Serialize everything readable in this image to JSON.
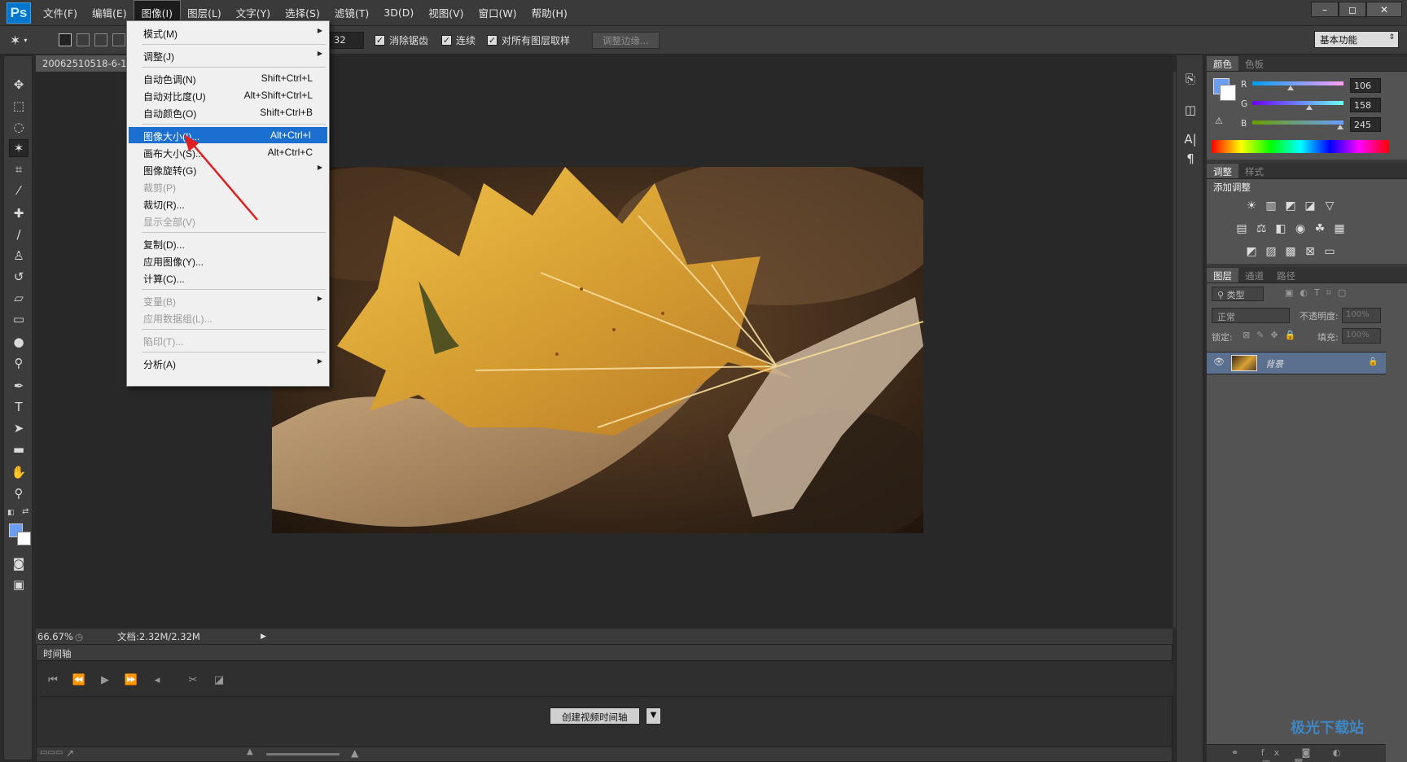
{
  "app": {
    "logo": "Ps"
  },
  "menubar": {
    "items": [
      "文件(F)",
      "编辑(E)",
      "图像(I)",
      "图层(L)",
      "文字(Y)",
      "选择(S)",
      "滤镜(T)",
      "3D(D)",
      "视图(V)",
      "窗口(W)",
      "帮助(H)"
    ],
    "active_index": 2
  },
  "window_controls": {
    "minimize": "–",
    "restore": "◻",
    "close": "✕"
  },
  "options": {
    "tolerance_value": "32",
    "antialias_label": "消除锯齿",
    "contiguous_label": "连续",
    "sample_all_label": "对所有图层取样",
    "refine_edge_label": "调整边缘...",
    "workspace_value": "基本功能"
  },
  "document": {
    "tab_title": "20062510518-6-12",
    "zoom": "66.67%",
    "doc_info": "文档:2.32M/2.32M"
  },
  "image_menu": [
    {
      "label": "模式(M)",
      "shortcut": "",
      "submenu": true,
      "disabled": false
    },
    {
      "separator": true
    },
    {
      "label": "调整(J)",
      "shortcut": "",
      "submenu": true,
      "disabled": false
    },
    {
      "separator": true
    },
    {
      "label": "自动色调(N)",
      "shortcut": "Shift+Ctrl+L",
      "disabled": false
    },
    {
      "label": "自动对比度(U)",
      "shortcut": "Alt+Shift+Ctrl+L",
      "disabled": false
    },
    {
      "label": "自动颜色(O)",
      "shortcut": "Shift+Ctrl+B",
      "disabled": false
    },
    {
      "separator": true
    },
    {
      "label": "图像大小(I)...",
      "shortcut": "Alt+Ctrl+I",
      "disabled": false,
      "highlighted": true
    },
    {
      "label": "画布大小(S)...",
      "shortcut": "Alt+Ctrl+C",
      "disabled": false
    },
    {
      "label": "图像旋转(G)",
      "shortcut": "",
      "submenu": true,
      "disabled": false
    },
    {
      "label": "裁剪(P)",
      "shortcut": "",
      "disabled": true
    },
    {
      "label": "裁切(R)...",
      "shortcut": "",
      "disabled": false
    },
    {
      "label": "显示全部(V)",
      "shortcut": "",
      "disabled": true
    },
    {
      "separator": true
    },
    {
      "label": "复制(D)...",
      "shortcut": "",
      "disabled": false
    },
    {
      "label": "应用图像(Y)...",
      "shortcut": "",
      "disabled": false
    },
    {
      "label": "计算(C)...",
      "shortcut": "",
      "disabled": false
    },
    {
      "separator": true
    },
    {
      "label": "变量(B)",
      "shortcut": "",
      "submenu": true,
      "disabled": true
    },
    {
      "label": "应用数据组(L)...",
      "shortcut": "",
      "disabled": true
    },
    {
      "separator": true
    },
    {
      "label": "陷印(T)...",
      "shortcut": "",
      "disabled": true
    },
    {
      "separator": true
    },
    {
      "label": "分析(A)",
      "shortcut": "",
      "submenu": true,
      "disabled": false
    }
  ],
  "timeline": {
    "title": "时间轴",
    "create_button": "创建视频时间轴"
  },
  "color_panel": {
    "tabs": [
      "颜色",
      "色板"
    ],
    "r_label": "R",
    "g_label": "G",
    "b_label": "B",
    "r": "106",
    "g": "158",
    "b": "245",
    "fg_color": "#6a9ef5"
  },
  "adjust_panel": {
    "tabs": [
      "调整",
      "样式"
    ],
    "title": "添加调整"
  },
  "layers_panel": {
    "tabs": [
      "图层",
      "通道",
      "路径"
    ],
    "filter_kind": "类型",
    "blend_mode": "正常",
    "opacity_label": "不透明度:",
    "opacity_value": "100%",
    "lock_label": "锁定:",
    "fill_label": "填充:",
    "fill_value": "100%",
    "layer_name": "背景"
  },
  "watermark": "极光下载站"
}
